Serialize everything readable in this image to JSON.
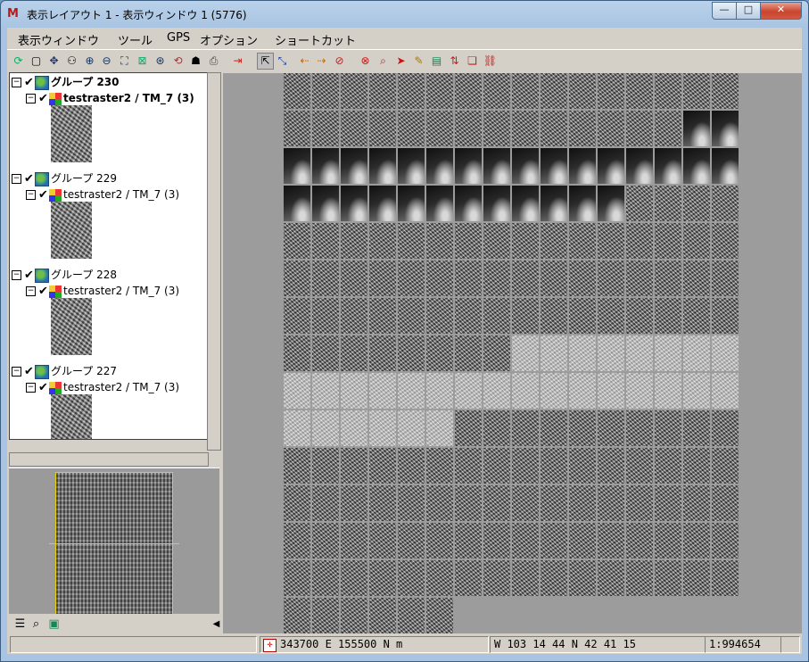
{
  "window": {
    "title": "表示レイアウト 1 ‐ 表示ウィンドウ 1 (5776)",
    "app_icon_text": "M"
  },
  "menu": [
    "表示ウィンドウ",
    "ツール",
    "GPS",
    "オプション",
    "ショートカット"
  ],
  "tree": {
    "groups": [
      {
        "label": "グループ 230",
        "layer": "testraster2 / TM_7 (3)",
        "active": true
      },
      {
        "label": "グループ 229",
        "layer": "testraster2 / TM_7 (3)",
        "active": false
      },
      {
        "label": "グループ 228",
        "layer": "testraster2 / TM_7 (3)",
        "active": false
      },
      {
        "label": "グループ 227",
        "layer": "testraster2 / TM_7 (3)",
        "active": false
      }
    ]
  },
  "status": {
    "message": "",
    "coordinate": "343700 E  155500 N m",
    "latlon": "W 103 14 44  N 42 41 15",
    "scale": "1:994654"
  },
  "tile_grid": {
    "columns": 16,
    "rows": 15,
    "last_row_count": 6,
    "rows_spec": [
      {
        "row": 0,
        "pattern": "tex"
      },
      {
        "row": 1,
        "pattern": "tex",
        "dark_from": 14
      },
      {
        "row": 2,
        "pattern": "dark"
      },
      {
        "row": 3,
        "pattern": "dark",
        "tex_from": 12
      },
      {
        "row": 4,
        "pattern": "tex"
      },
      {
        "row": 5,
        "pattern": "tex"
      },
      {
        "row": 6,
        "pattern": "tex"
      },
      {
        "row": 7,
        "pattern": "tex",
        "light_from": 8
      },
      {
        "row": 8,
        "pattern": "light"
      },
      {
        "row": 9,
        "pattern": "light",
        "tex_from": 6
      },
      {
        "row": 10,
        "pattern": "tex"
      },
      {
        "row": 11,
        "pattern": "tex"
      },
      {
        "row": 12,
        "pattern": "tex"
      },
      {
        "row": 13,
        "pattern": "tex"
      },
      {
        "row": 14,
        "pattern": "tex"
      }
    ]
  }
}
